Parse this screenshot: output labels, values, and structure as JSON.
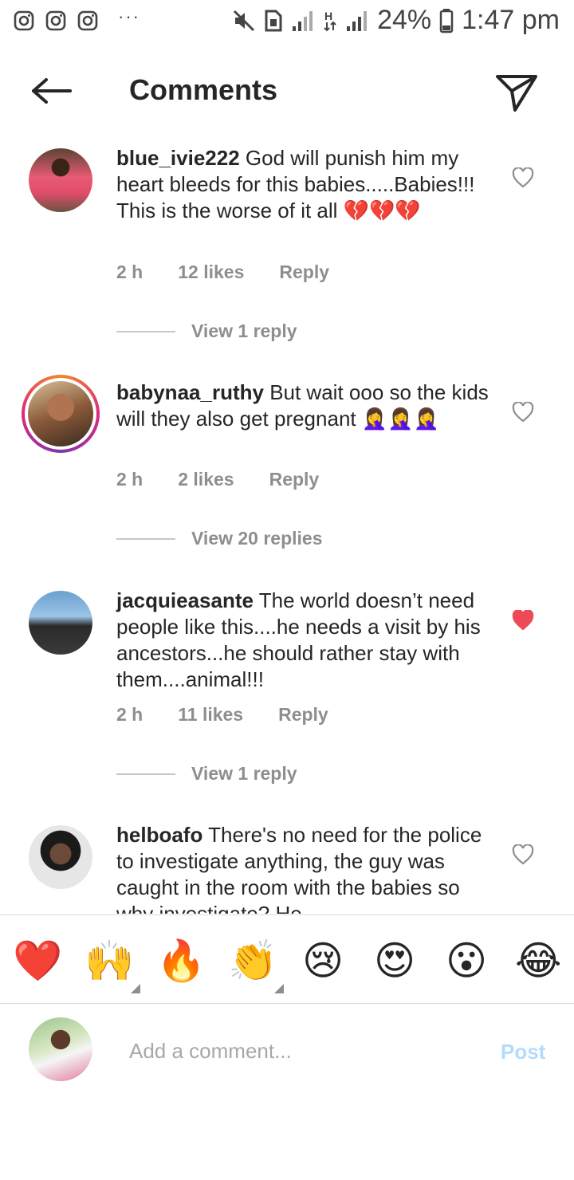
{
  "status_bar": {
    "app_icons": [
      "instagram-icon",
      "instagram-icon",
      "instagram-icon"
    ],
    "more": "···",
    "battery": "24%",
    "time": "1:47 pm"
  },
  "header": {
    "title": "Comments"
  },
  "comments": [
    {
      "username": "blue_ivie222",
      "text": "God will punish him my heart bleeds for this babies.....Babies!!! This is the worse of it all 💔💔💔",
      "time": "2 h",
      "likes": "12 likes",
      "reply": "Reply",
      "view_replies": "View 1 reply",
      "liked": false
    },
    {
      "username": "babynaa_ruthy",
      "text": "But wait ooo so the kids will they also get pregnant 🤦‍♀️🤦‍♀️🤦‍♀️",
      "time": "2 h",
      "likes": "2 likes",
      "reply": "Reply",
      "view_replies": "View 20 replies",
      "liked": false,
      "has_story": true
    },
    {
      "username": "jacquieasante",
      "text": "The world doesn’t need people like this....he needs a visit by his ancestors...he should rather stay with them....animal!!!",
      "time": "2 h",
      "likes": "11 likes",
      "reply": "Reply",
      "view_replies": "View 1 reply",
      "liked": true
    },
    {
      "username": "helboafo",
      "text": "There's no need for the police to investigate anything, the guy was caught in the room with the babies so why investigate? He",
      "liked": false
    }
  ],
  "emoji_bar": [
    "❤️",
    "🙌",
    "🔥",
    "👏",
    "😢",
    "😍",
    "😮",
    "😂"
  ],
  "comment_box": {
    "placeholder": "Add a comment...",
    "post_label": "Post"
  },
  "colors": {
    "liked_heart": "#ed4956",
    "post_disabled": "#b3dbff",
    "meta_gray": "#8e8e8e"
  }
}
